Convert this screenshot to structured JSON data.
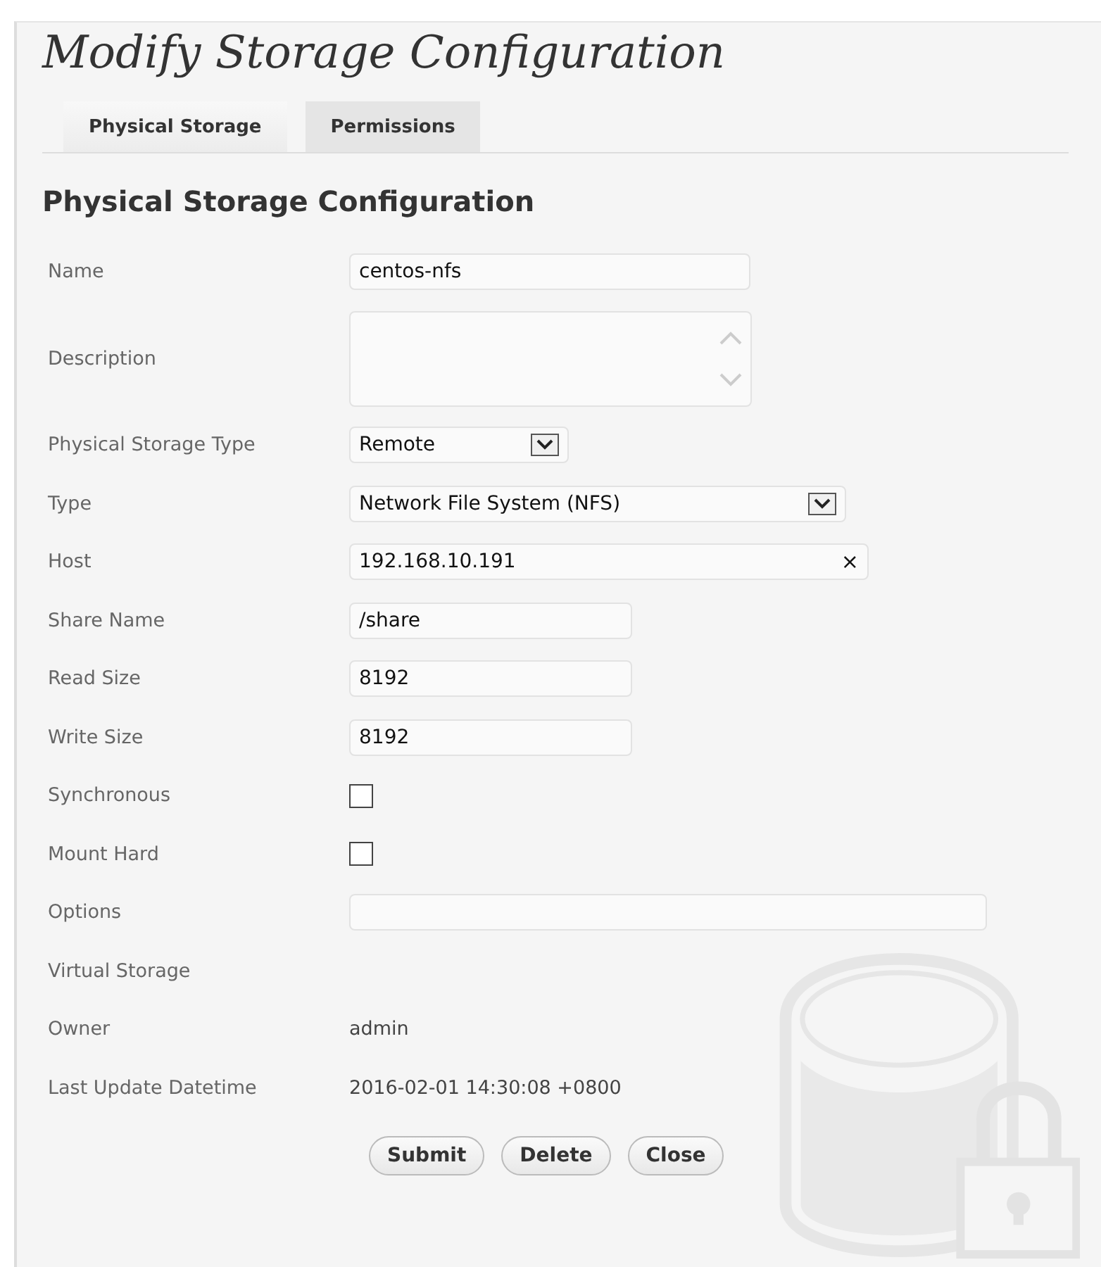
{
  "title": "Modify Storage Configuration",
  "tabs": [
    {
      "label": "Physical Storage",
      "selected": true
    },
    {
      "label": "Permissions",
      "selected": false
    }
  ],
  "section_title": "Physical Storage Configuration",
  "fields": [
    {
      "kind": "text",
      "label": "Name",
      "value": "centos-nfs"
    },
    {
      "kind": "textarea",
      "label": "Description"
    },
    {
      "kind": "select",
      "label": "Physical Storage Type",
      "value": "Remote"
    },
    {
      "kind": "select",
      "label": "Type",
      "value": "Network File System (NFS)"
    },
    {
      "kind": "clearable",
      "label": "Host",
      "value": "192.168.10.191",
      "clear": "×"
    },
    {
      "kind": "text",
      "label": "Share Name",
      "value": "/share"
    },
    {
      "kind": "text",
      "label": "Read Size",
      "value": "8192"
    },
    {
      "kind": "text",
      "label": "Write Size",
      "value": "8192"
    },
    {
      "kind": "checkbox",
      "label": "Synchronous",
      "checked": false
    },
    {
      "kind": "checkbox",
      "label": "Mount Hard",
      "checked": false
    },
    {
      "kind": "text",
      "label": "Options"
    },
    {
      "kind": "label",
      "label": "Virtual Storage"
    },
    {
      "kind": "value",
      "label": "Owner",
      "value": "admin"
    },
    {
      "kind": "value",
      "label": "Last Update Datetime",
      "value": "2016-02-01 14:30:08 +0800"
    }
  ],
  "buttons": [
    "Submit",
    "Delete",
    "Close"
  ]
}
